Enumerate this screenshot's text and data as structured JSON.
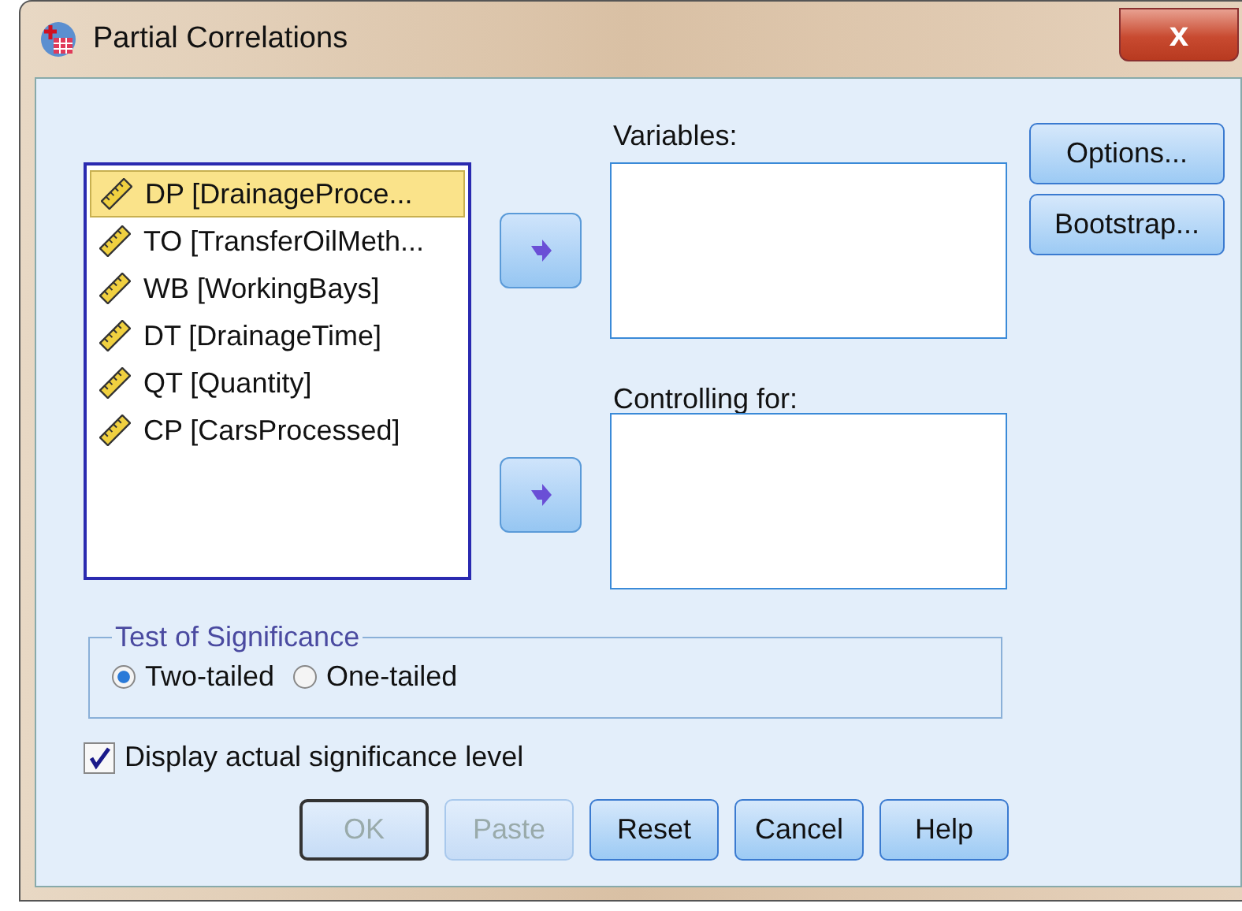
{
  "window": {
    "title": "Partial Correlations",
    "close": "x"
  },
  "source_list": [
    {
      "label": "DP [DrainageProce...",
      "selected": true
    },
    {
      "label": "TO [TransferOilMeth...",
      "selected": false
    },
    {
      "label": "WB [WorkingBays]",
      "selected": false
    },
    {
      "label": "DT [DrainageTime]",
      "selected": false
    },
    {
      "label": "QT [Quantity]",
      "selected": false
    },
    {
      "label": "CP [CarsProcessed]",
      "selected": false
    }
  ],
  "variables": {
    "label": "Variables:"
  },
  "controlling": {
    "label": "Controlling for:"
  },
  "side_buttons": [
    "Options...",
    "Bootstrap..."
  ],
  "test_of_significance": {
    "title": "Test of Significance",
    "options": [
      {
        "label": "Two-tailed",
        "selected": true
      },
      {
        "label": "One-tailed",
        "selected": false
      }
    ]
  },
  "display_actual": {
    "label": "Display actual significance level",
    "checked": true
  },
  "buttons": [
    {
      "label": "OK",
      "disabled": true,
      "default": true
    },
    {
      "label": "Paste",
      "disabled": true,
      "default": false
    },
    {
      "label": "Reset",
      "disabled": false,
      "default": false
    },
    {
      "label": "Cancel",
      "disabled": false,
      "default": false
    },
    {
      "label": "Help",
      "disabled": false,
      "default": false
    }
  ]
}
